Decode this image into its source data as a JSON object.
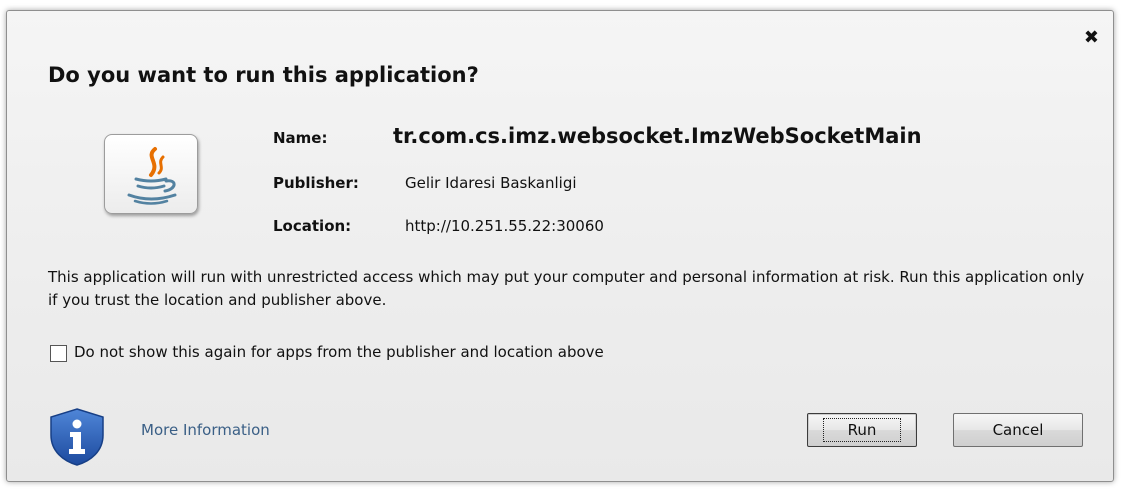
{
  "dialog": {
    "title": "Do you want to run this application?",
    "close_glyph": "✖"
  },
  "app": {
    "icon": "java-icon",
    "name_label": "Name:",
    "name_value": "tr.com.cs.imz.websocket.ImzWebSocketMain",
    "publisher_label": "Publisher:",
    "publisher_value": "Gelir Idaresi Baskanligi",
    "location_label": "Location:",
    "location_value": "http://10.251.55.22:30060"
  },
  "warning_text": "This application will run with unrestricted access which may put your computer and personal information at risk. Run this application only if you trust the location and publisher above.",
  "checkbox": {
    "label": "Do not show this again for apps from the publisher and location above",
    "checked": false
  },
  "footer": {
    "info_icon": "shield-info-icon",
    "more_info": "More Information",
    "run_label": "Run",
    "cancel_label": "Cancel"
  },
  "colors": {
    "link": "#3a5f86",
    "shield": "#2d5fb8",
    "java_orange": "#e76f00",
    "java_blue": "#5382a1"
  }
}
